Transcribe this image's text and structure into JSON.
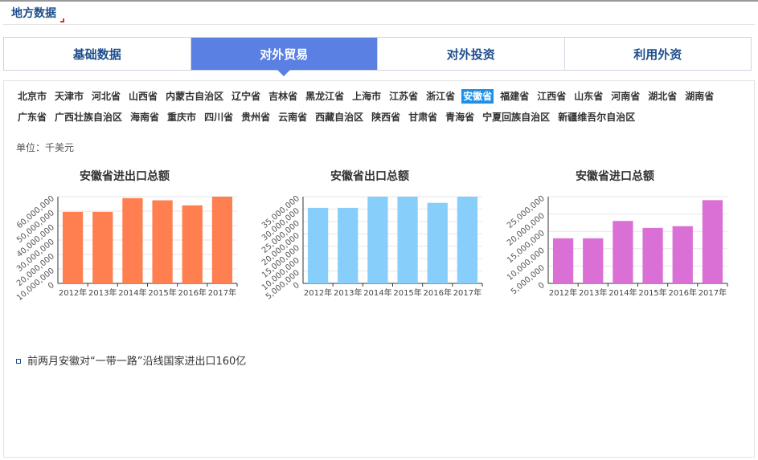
{
  "section": {
    "title": "地方数据"
  },
  "tabs": [
    {
      "label": "基础数据",
      "active": false
    },
    {
      "label": "对外贸易",
      "active": true
    },
    {
      "label": "对外投资",
      "active": false
    },
    {
      "label": "利用外资",
      "active": false
    }
  ],
  "provinces": [
    "北京市",
    "天津市",
    "河北省",
    "山西省",
    "内蒙古自治区",
    "辽宁省",
    "吉林省",
    "黑龙江省",
    "上海市",
    "江苏省",
    "浙江省",
    "安徽省",
    "福建省",
    "江西省",
    "山东省",
    "河南省",
    "湖北省",
    "湖南省",
    "广东省",
    "广西壮族自治区",
    "海南省",
    "重庆市",
    "四川省",
    "贵州省",
    "云南省",
    "西藏自治区",
    "陕西省",
    "甘肃省",
    "青海省",
    "宁夏回族自治区",
    "新疆维吾尔自治区"
  ],
  "selected_province": "安徽省",
  "unit": "单位：千美元",
  "colors": {
    "total": "#ff7f50",
    "export": "#87cefa",
    "import": "#da70d6",
    "accent": "#5b80e3"
  },
  "chart_data": [
    {
      "type": "bar",
      "title": "安徽省进出口总额",
      "categories": [
        "2012年",
        "2013年",
        "2014年",
        "2015年",
        "2016年",
        "2017年"
      ],
      "values": [
        49500000,
        49500000,
        59000000,
        57500000,
        54000000,
        63500000
      ],
      "ylim": [
        0,
        60000000
      ],
      "yticks": [
        "0",
        "10,000,000",
        "20,000,000",
        "30,000,000",
        "40,000,000",
        "50,000,000",
        "60,000,000"
      ],
      "xlabel": "",
      "ylabel": ""
    },
    {
      "type": "bar",
      "title": "安徽省出口总额",
      "categories": [
        "2012年",
        "2013年",
        "2014年",
        "2015年",
        "2016年",
        "2017年"
      ],
      "values": [
        30500000,
        30500000,
        36000000,
        37000000,
        32500000,
        35000000
      ],
      "ylim": [
        0,
        35000000
      ],
      "yticks": [
        "0",
        "5,000,000",
        "10,000,000",
        "15,000,000",
        "20,000,000",
        "25,000,000",
        "30,000,000",
        "35,000,000"
      ],
      "xlabel": "",
      "ylabel": ""
    },
    {
      "type": "bar",
      "title": "安徽省进口总额",
      "categories": [
        "2012年",
        "2013年",
        "2014年",
        "2015年",
        "2016年",
        "2017年"
      ],
      "values": [
        13000000,
        13000000,
        18000000,
        16000000,
        16500000,
        24000000
      ],
      "ylim": [
        0,
        25000000
      ],
      "yticks": [
        "0",
        "5,000,000",
        "10,000,000",
        "15,000,000",
        "20,000,000",
        "25,000,000"
      ],
      "xlabel": "",
      "ylabel": ""
    }
  ],
  "news": [
    {
      "text": "前两月安徽对“一带一路”沿线国家进出口160亿"
    }
  ]
}
